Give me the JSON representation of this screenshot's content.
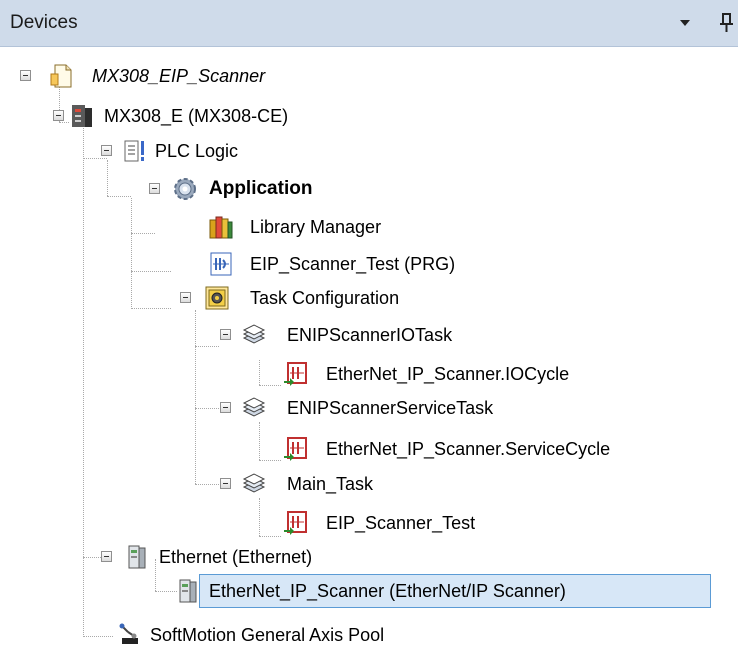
{
  "panel": {
    "title": "Devices",
    "dropdown_icon": "caret-down-icon",
    "pin_icon": "pushpin-icon"
  },
  "tree": {
    "project": "MX308_EIP_Scanner",
    "device": "MX308_E (MX308-CE)",
    "plc_logic": "PLC Logic",
    "application": "Application",
    "library_manager": "Library Manager",
    "eip_scanner_test_prg": "EIP_Scanner_Test (PRG)",
    "task_configuration": "Task Configuration",
    "enip_io_task": "ENIPScannerIOTask",
    "io_cycle_call": "EtherNet_IP_Scanner.IOCycle",
    "enip_service_task": "ENIPScannerServiceTask",
    "service_cycle_call": "EtherNet_IP_Scanner.ServiceCycle",
    "main_task": "Main_Task",
    "main_task_call": "EIP_Scanner_Test",
    "ethernet": "Ethernet (Ethernet)",
    "ethernet_ip_scanner": "EtherNet_IP_Scanner (EtherNet/IP Scanner)",
    "softmotion_pool": "SoftMotion General Axis Pool"
  },
  "selected_item": "EtherNet_IP_Scanner (EtherNet/IP Scanner)",
  "colors": {
    "header_bg": "#cfdbea",
    "selection_bg": "#d7e7f7",
    "selection_border": "#5b9bd5"
  }
}
